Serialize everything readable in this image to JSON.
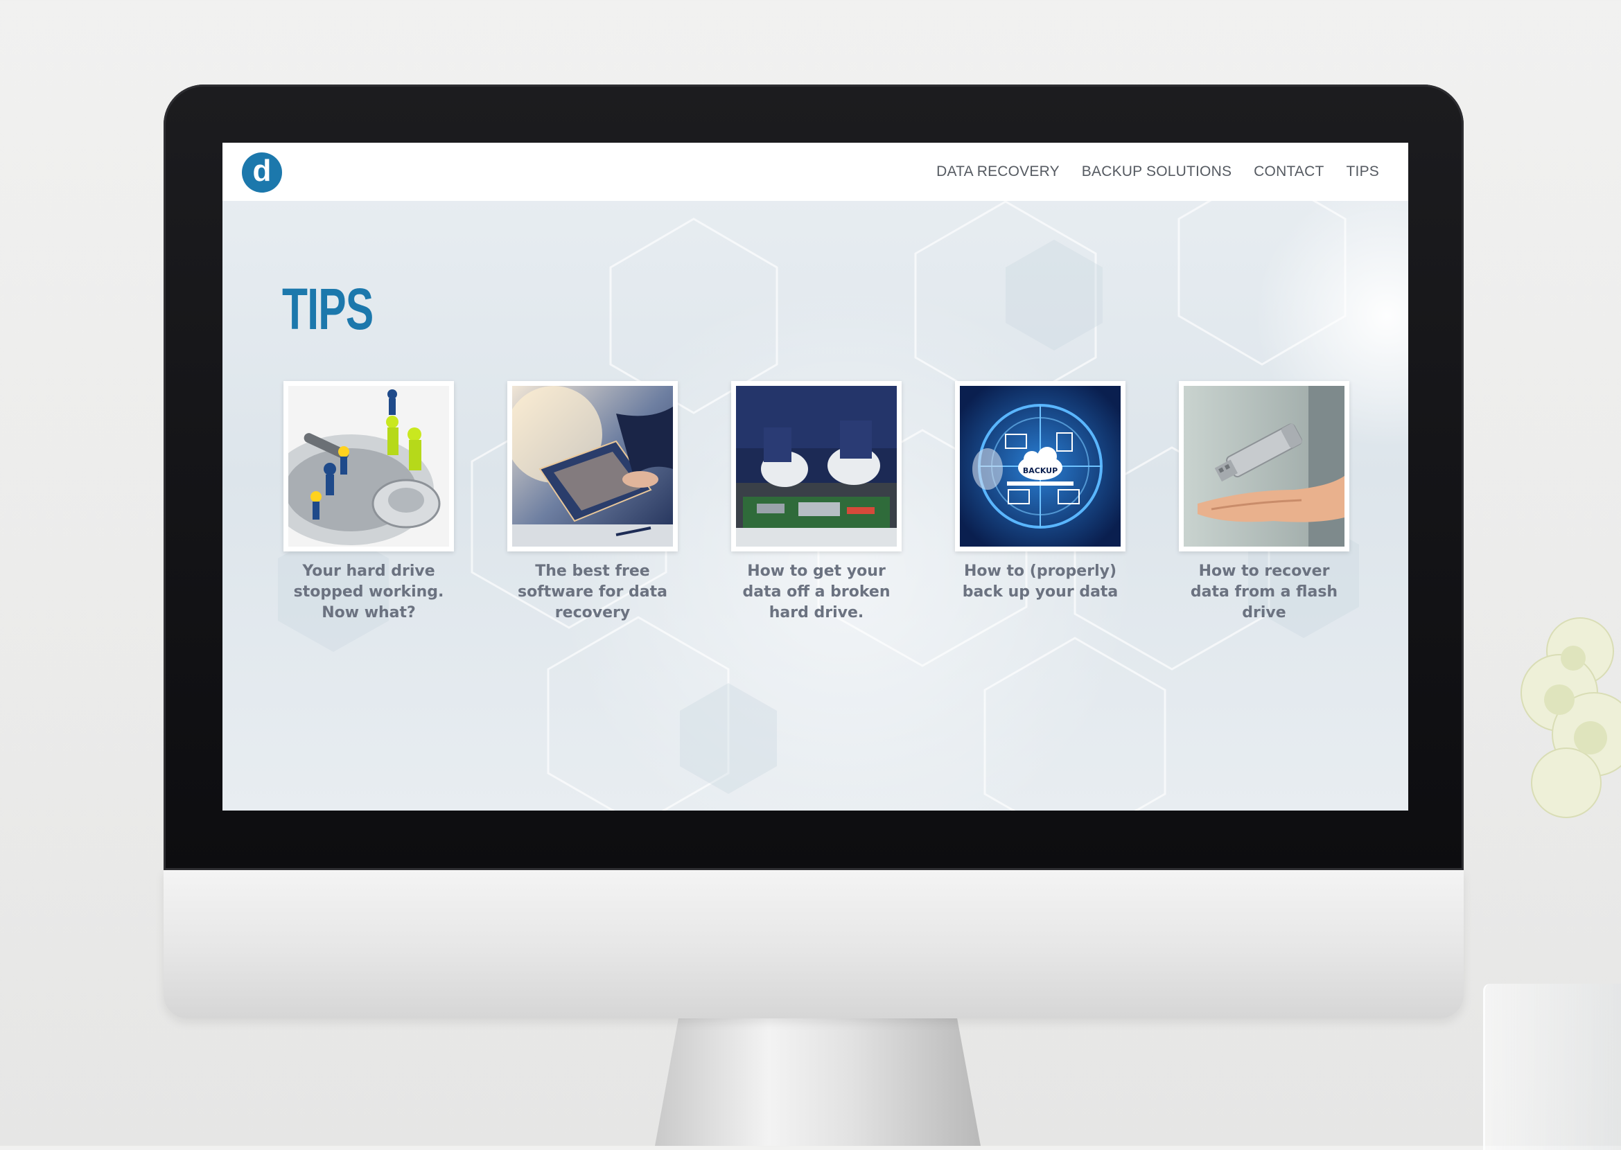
{
  "site": {
    "logo_letter": "d",
    "nav": [
      {
        "label": "DATA RECOVERY"
      },
      {
        "label": "BACKUP SOLUTIONS"
      },
      {
        "label": "CONTACT"
      },
      {
        "label": "TIPS"
      }
    ]
  },
  "main": {
    "title": "TIPS",
    "cards": [
      {
        "caption": "Your hard drive stopped working. Now what?",
        "image_icon": "hard-drive-workers-image"
      },
      {
        "caption": "The best free software for data recovery",
        "image_icon": "laptop-hands-image"
      },
      {
        "caption": "How to get your data off a broken hard drive.",
        "image_icon": "gloved-hands-repair-image"
      },
      {
        "caption": "How to (properly) back up your data",
        "image_icon": "cloud-backup-network-image",
        "image_label": "BACKUP"
      },
      {
        "caption": "How to recover data from a flash drive",
        "image_icon": "flash-drive-hand-image"
      }
    ]
  },
  "colors": {
    "accent": "#1c78ac",
    "caption": "#6b7280",
    "nav_text": "#555a61"
  }
}
